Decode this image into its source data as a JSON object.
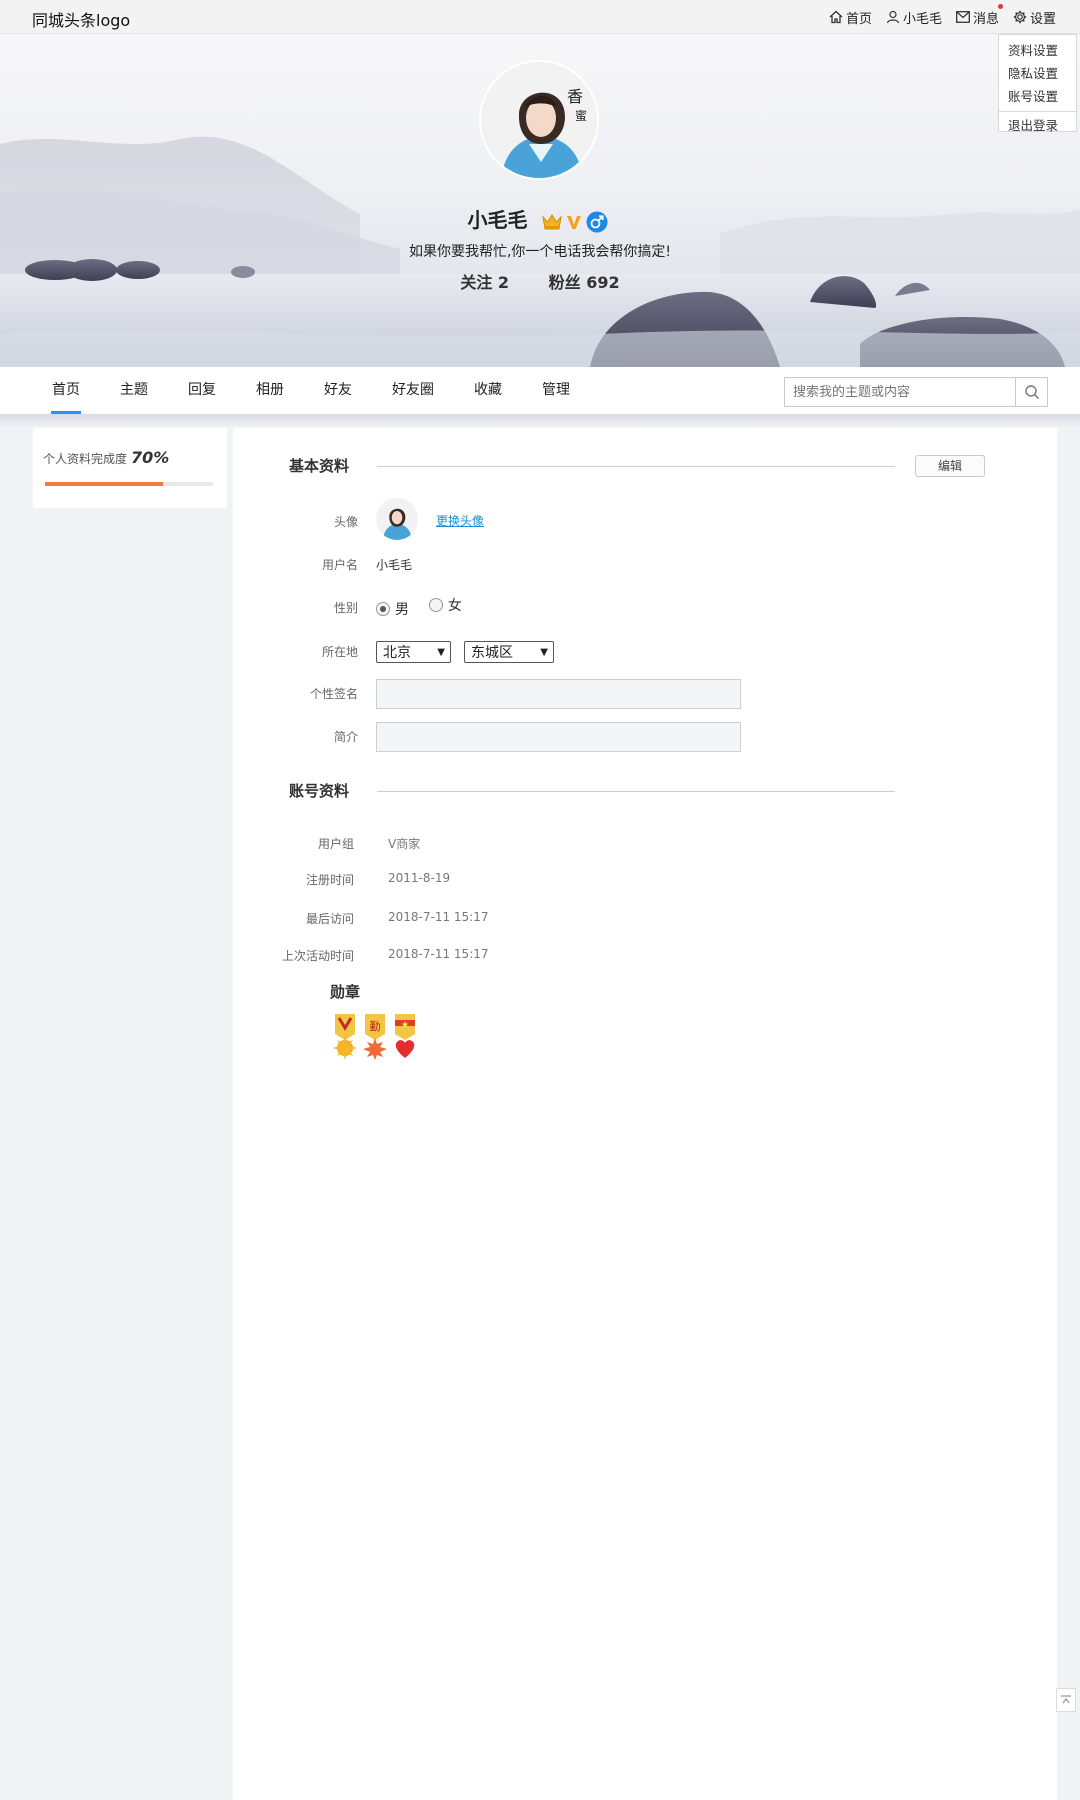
{
  "topbar": {
    "logo": "同城头条logo",
    "nav": {
      "home": "首页",
      "user": "小毛毛",
      "messages": "消息",
      "settings": "设置"
    },
    "dropdown": {
      "profile_settings": "资料设置",
      "privacy_settings": "隐私设置",
      "account_settings": "账号设置",
      "logout": "退出登录"
    }
  },
  "profile": {
    "name": "小毛毛",
    "signature": "如果你要我帮忙,你一个电话我会帮你搞定!",
    "following_label": "关注 2",
    "fans_label": "粉丝 692"
  },
  "nav": {
    "tabs": [
      "首页",
      "主题",
      "回复",
      "相册",
      "好友",
      "好友圈",
      "收藏",
      "管理"
    ],
    "search_placeholder": "搜索我的主题或内容"
  },
  "sidebar": {
    "completion_label": "个人资料完成度",
    "completion_value": "70%",
    "completion_fraction": 0.7
  },
  "basic": {
    "title": "基本资料",
    "edit_label": "编辑",
    "avatar_label": "头像",
    "change_avatar": "更换头像",
    "username_label": "用户名",
    "username_value": "小毛毛",
    "gender_label": "性别",
    "gender_male": "男",
    "gender_female": "女",
    "location_label": "所在地",
    "city": "北京",
    "district": "东城区",
    "signature_label": "个性签名",
    "intro_label": "简介"
  },
  "account": {
    "title": "账号资料",
    "group_label": "用户组",
    "group_value": "V商家",
    "reg_label": "注册时间",
    "reg_value": "2011-8-19",
    "last_visit_label": "最后访问",
    "last_visit_value": "2018-7-11 15:17",
    "last_active_label": "上次活动时间",
    "last_active_value": "2018-7-11 15:17",
    "medals_label": "勋章"
  },
  "colors": {
    "accent_blue": "#2a8ff7",
    "progress_orange": "#f27c3e",
    "link_blue": "#1a8fd8"
  }
}
